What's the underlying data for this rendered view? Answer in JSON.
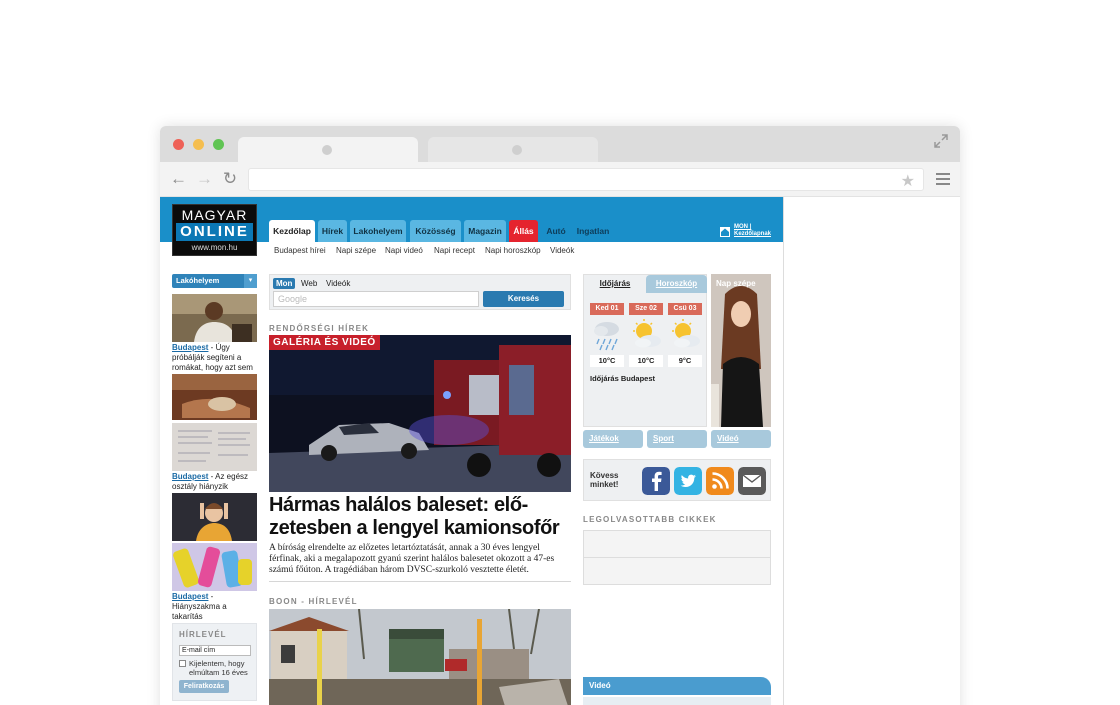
{
  "site": {
    "logo": {
      "line1": "MAGYAR",
      "line2": "ONLINE",
      "line3": "www.mon.hu"
    },
    "mainnav": [
      {
        "label": "Kezdőlap",
        "state": "active"
      },
      {
        "label": "Hírek",
        "state": "normal"
      },
      {
        "label": "Lakohelyem",
        "state": "normal"
      },
      {
        "label": "Közösség",
        "state": "normal"
      },
      {
        "label": "Magazin",
        "state": "normal"
      },
      {
        "label": "Állás",
        "state": "red"
      },
      {
        "label": "Autó",
        "state": "plain"
      },
      {
        "label": "Ingatlan",
        "state": "plain"
      }
    ],
    "mon_link": {
      "line1": "MON |",
      "line2": "Kezdőlapnak"
    },
    "subnav": [
      "Budapest hírei",
      "Napi szépe",
      "Napi videó",
      "Napi recept",
      "Napi horoszkóp",
      "Videók"
    ]
  },
  "left": {
    "lakohely_label": "Lakóhelyem",
    "captions": [
      {
        "city": "Budapest",
        "text": " - Úgy próbálják segíteni a romákat, hogy azt sem tudjuk, kik azok"
      },
      {
        "city": "Budapest",
        "text": " - Az egész osztály hiányzik"
      },
      {
        "city": "Budapest",
        "text": " - Hiányszakma a takarítás"
      }
    ],
    "newsletter": {
      "title": "HÍRLEVÉL",
      "email_value": "E-mail cím",
      "checkbox_label": "Kijelentem, hogy elmúltam 16 éves",
      "button": "Feliratkozás"
    }
  },
  "search": {
    "tabs": [
      "Mon",
      "Web",
      "Videók"
    ],
    "placeholder": "Google",
    "button": "Keresés"
  },
  "middle": {
    "section1": "RENDŐRSÉGI HÍREK",
    "badge": "GALÉRIA ÉS VIDEÓ",
    "headline_line1": "Hármas halálos baleset: elő-",
    "headline_line2": "zetesben a lengyel kamionsofőr",
    "lead": "A bíróság elrendelte az előzetes letartóztatását, annak a 30 éves lengyel férfinak, aki a megalapozott gyanú szerint halálos balesetet okozott a 47-es számú főúton. A tragédiában három DVSC-szurkoló vesztette életét.",
    "section2": "BOON - HÍRLEVÉL"
  },
  "right": {
    "weather_tab": "Időjárás",
    "horoscope_tab": "Horoszkóp",
    "days": [
      {
        "label": "Ked 01",
        "temp": "10°C",
        "icon": "rain-cloud-icon"
      },
      {
        "label": "Sze 02",
        "temp": "10°C",
        "icon": "sun-cloud-icon"
      },
      {
        "label": "Csü 03",
        "temp": "9°C",
        "icon": "sun-cloud-icon"
      }
    ],
    "weather_city": "Időjárás Budapest",
    "napszepe_label": "Nap szépe",
    "buttons": [
      "Játékok",
      "Sport",
      "Videó"
    ],
    "follow_line1": "Kövess",
    "follow_line2": "minket!",
    "social_icons": [
      "facebook-icon",
      "twitter-icon",
      "rss-icon",
      "email-icon"
    ],
    "colors": {
      "facebook": "#3b5998",
      "twitter": "#33b3e3",
      "rss": "#f08a1c",
      "email": "#5a5a5a"
    },
    "most_read": "LEGOLVASOTTABB CIKKEK",
    "video_bar": "Videó"
  }
}
